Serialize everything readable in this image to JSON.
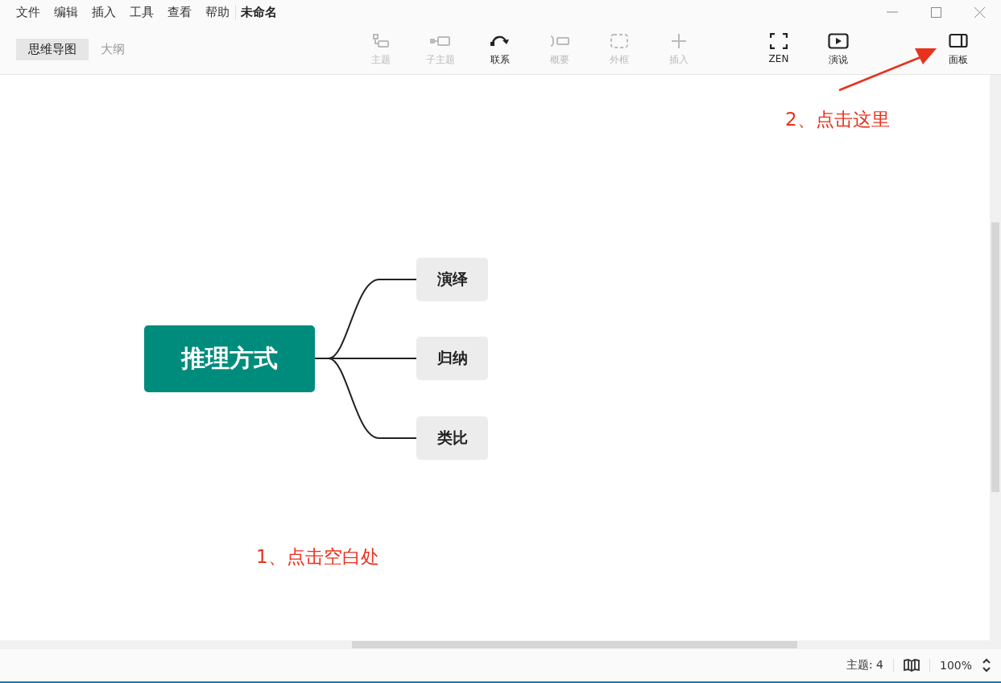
{
  "menu": [
    "文件",
    "编辑",
    "插入",
    "工具",
    "查看",
    "帮助"
  ],
  "document_title": "未命名",
  "view_tabs": [
    {
      "label": "思维导图",
      "selected": true
    },
    {
      "label": "大纲",
      "selected": false
    }
  ],
  "tools": [
    {
      "kind": "topic",
      "label": "主题",
      "disabled": true
    },
    {
      "kind": "subtopic",
      "label": "子主题",
      "disabled": true
    },
    {
      "kind": "relation",
      "label": "联系",
      "disabled": false
    },
    {
      "kind": "summary",
      "label": "概要",
      "disabled": true
    },
    {
      "kind": "boundary",
      "label": "外框",
      "disabled": true
    },
    {
      "kind": "insert",
      "label": "插入",
      "disabled": true
    }
  ],
  "right_tools": [
    {
      "kind": "zen",
      "label": "ZEN"
    },
    {
      "kind": "present",
      "label": "演说"
    },
    {
      "kind": "panel",
      "label": "面板"
    }
  ],
  "mindmap": {
    "root": "推理方式",
    "children": [
      "演绎",
      "归纳",
      "类比"
    ]
  },
  "annotations": [
    "1、点击空白处",
    "2、点击这里"
  ],
  "status_bar": {
    "topic_count": "主题: 4",
    "zoom": "100%"
  }
}
